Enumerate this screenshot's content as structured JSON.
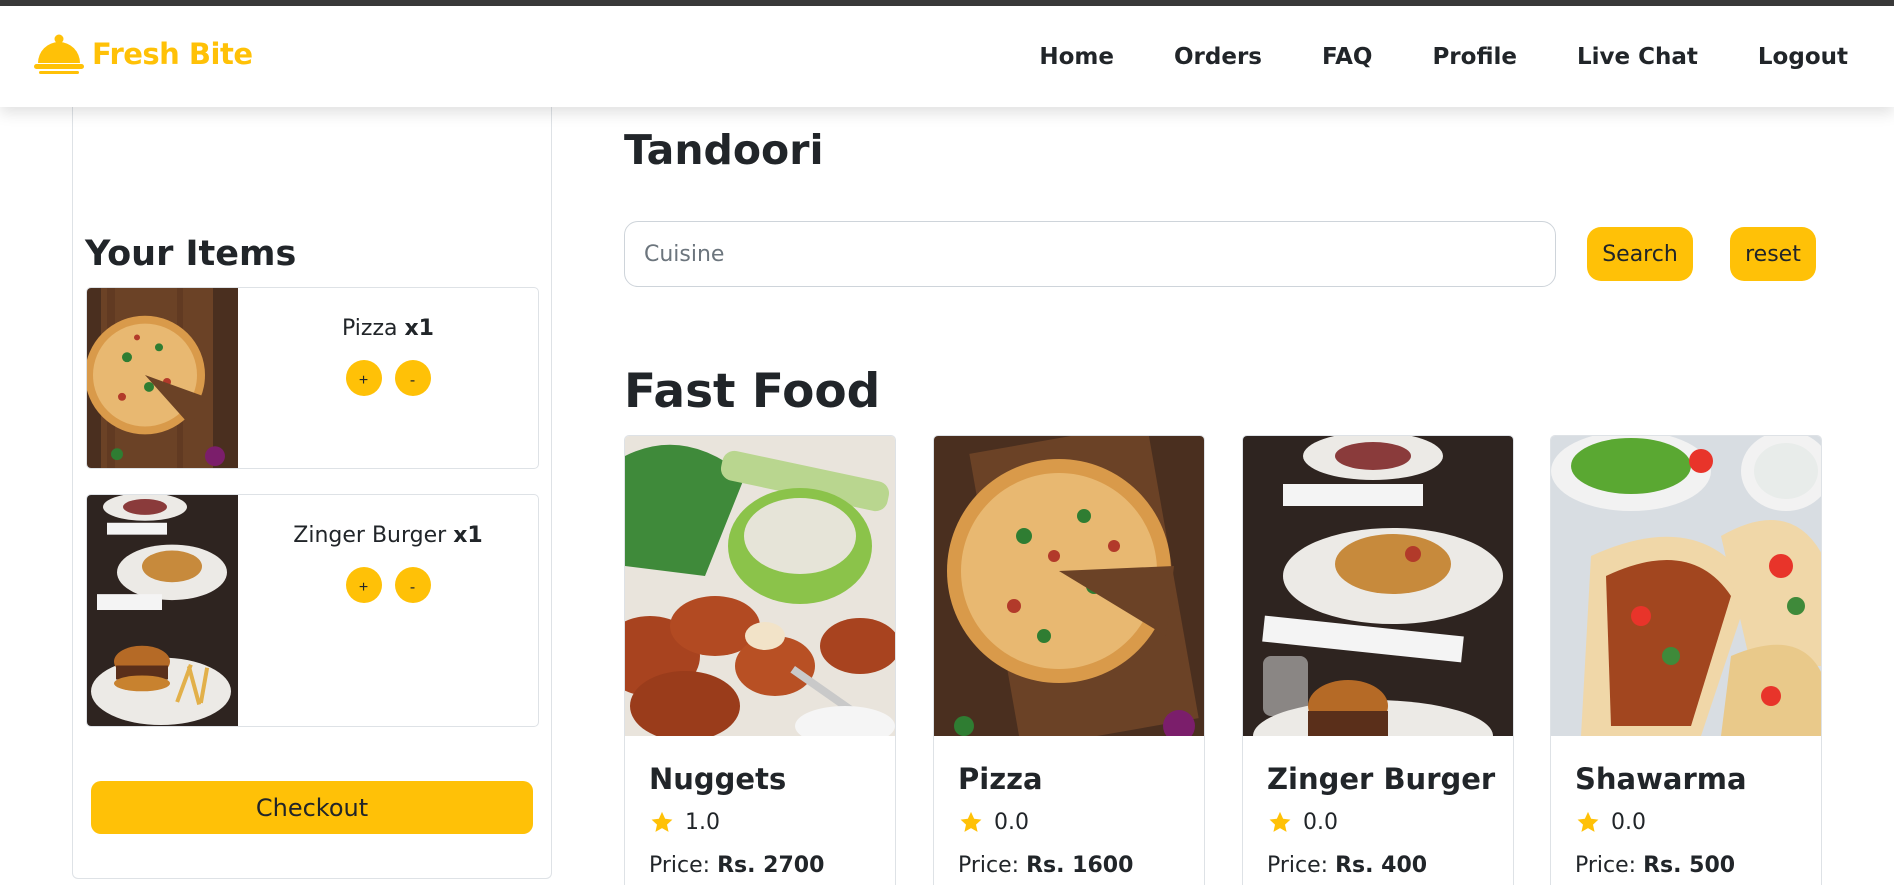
{
  "brand": {
    "name": "Fresh Bite",
    "logo_icon": "cloche-icon",
    "color": "#ffc107"
  },
  "nav": {
    "links": [
      "Home",
      "Orders",
      "FAQ",
      "Profile",
      "Live Chat",
      "Logout"
    ]
  },
  "sidebar": {
    "title": "Your Items",
    "items": [
      {
        "name": "Pizza",
        "qty": "x1",
        "plus": "+",
        "minus": "-"
      },
      {
        "name": "Zinger Burger",
        "qty": "x1",
        "plus": "+",
        "minus": "-"
      }
    ],
    "checkout_label": "Checkout"
  },
  "main": {
    "category_title": "Tandoori",
    "search": {
      "placeholder": "Cuisine",
      "value": "",
      "search_label": "Search",
      "reset_label": "reset"
    },
    "section_title": "Fast Food",
    "products": [
      {
        "name": "Nuggets",
        "rating": "1.0",
        "price_label": "Price:",
        "price": "Rs. 2700"
      },
      {
        "name": "Pizza",
        "rating": "0.0",
        "price_label": "Price:",
        "price": "Rs. 1600"
      },
      {
        "name": "Zinger Burger",
        "rating": "0.0",
        "price_label": "Price:",
        "price": "Rs. 400"
      },
      {
        "name": "Shawarma",
        "rating": "0.0",
        "price_label": "Price:",
        "price": "Rs. 500"
      }
    ]
  },
  "colors": {
    "accent": "#ffc107",
    "text": "#212529",
    "border": "#dee2e6"
  }
}
